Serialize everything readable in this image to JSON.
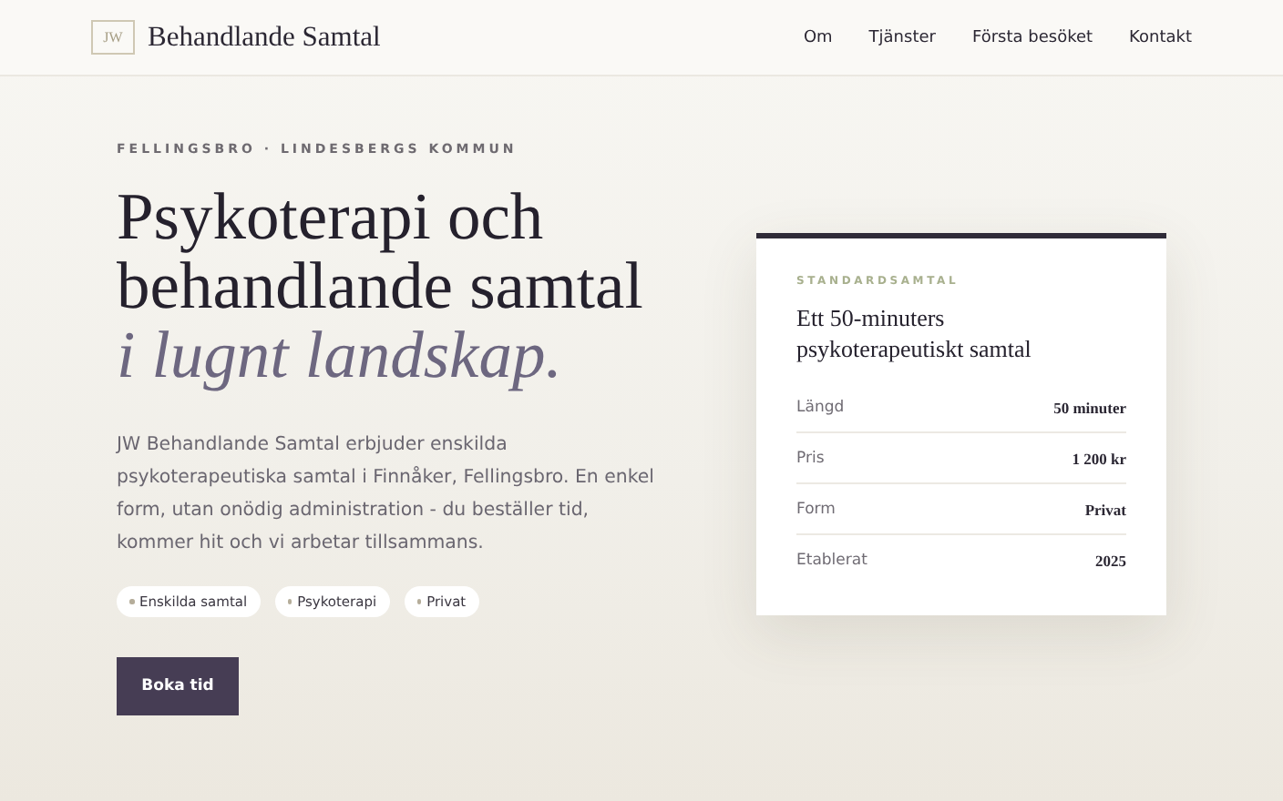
{
  "header": {
    "logo_mark": "JW",
    "brand": "Behandlande Samtal",
    "nav": [
      {
        "label": "Om"
      },
      {
        "label": "Tjänster"
      },
      {
        "label": "Första besöket"
      },
      {
        "label": "Kontakt"
      }
    ]
  },
  "hero": {
    "eyebrow": "FELLINGSBRO · LINDESBERGS KOMMUN",
    "title_lines": [
      "Psykoterapi och",
      "behandlande samtal"
    ],
    "title_accent": "i lugnt landskap.",
    "intro": "JW Behandlande Samtal erbjuder enskilda psykoterapeutiska samtal i Finnåker, Fellingsbro. En enkel form, utan onödig administration - du beställer tid, kommer hit och vi arbetar tillsammans.",
    "tags": [
      "Enskilda samtal",
      "Psykoterapi",
      "Privat"
    ],
    "button": "Boka tid"
  },
  "card": {
    "eyebrow": "STANDARDSAMTAL",
    "title": "Ett 50-minuters psykoterapeutiskt samtal",
    "rows": [
      {
        "label": "Längd",
        "value": "50 minuter"
      },
      {
        "label": "Pris",
        "value": "1 200 kr"
      },
      {
        "label": "Form",
        "value": "Privat"
      },
      {
        "label": "Etablerat",
        "value": "2025"
      }
    ]
  }
}
